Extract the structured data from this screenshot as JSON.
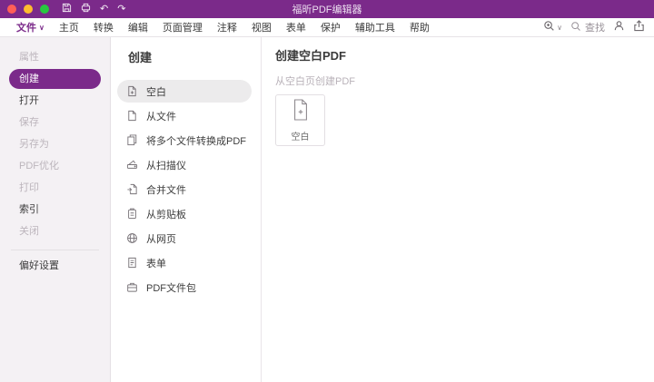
{
  "colors": {
    "accent": "#7b2a8a",
    "titlebar": "#7b2a8a",
    "selected_pill": "#ecebec"
  },
  "titlebar": {
    "title": "福昕PDF编辑器"
  },
  "menubar": {
    "items": [
      {
        "label": "文件",
        "active": true
      },
      {
        "label": "主页"
      },
      {
        "label": "转换"
      },
      {
        "label": "编辑"
      },
      {
        "label": "页面管理"
      },
      {
        "label": "注释"
      },
      {
        "label": "视图"
      },
      {
        "label": "表单"
      },
      {
        "label": "保护"
      },
      {
        "label": "辅助工具"
      },
      {
        "label": "帮助"
      }
    ],
    "find_label": "查找"
  },
  "sidebar": {
    "items": [
      {
        "label": "属性",
        "state": "disabled"
      },
      {
        "label": "创建",
        "state": "selected"
      },
      {
        "label": "打开",
        "state": "normal"
      },
      {
        "label": "保存",
        "state": "disabled"
      },
      {
        "label": "另存为",
        "state": "disabled"
      },
      {
        "label": "PDF优化",
        "state": "disabled"
      },
      {
        "label": "打印",
        "state": "disabled"
      },
      {
        "label": "索引",
        "state": "normal"
      },
      {
        "label": "关闭",
        "state": "disabled"
      }
    ],
    "footer": {
      "label": "偏好设置"
    }
  },
  "create_panel": {
    "title": "创建",
    "items": [
      {
        "label": "空白",
        "icon": "blank-page-plus-icon",
        "selected": true
      },
      {
        "label": "从文件",
        "icon": "from-file-icon"
      },
      {
        "label": "将多个文件转换成PDF",
        "icon": "multiple-files-icon"
      },
      {
        "label": "从扫描仪",
        "icon": "scanner-icon"
      },
      {
        "label": "合并文件",
        "icon": "combine-files-icon"
      },
      {
        "label": "从剪贴板",
        "icon": "clipboard-icon"
      },
      {
        "label": "从网页",
        "icon": "web-page-icon"
      },
      {
        "label": "表单",
        "icon": "form-icon"
      },
      {
        "label": "PDF文件包",
        "icon": "pdf-portfolio-icon"
      }
    ]
  },
  "main": {
    "title": "创建空白PDF",
    "subtitle": "从空白页创建PDF",
    "card": {
      "label": "空白"
    }
  }
}
